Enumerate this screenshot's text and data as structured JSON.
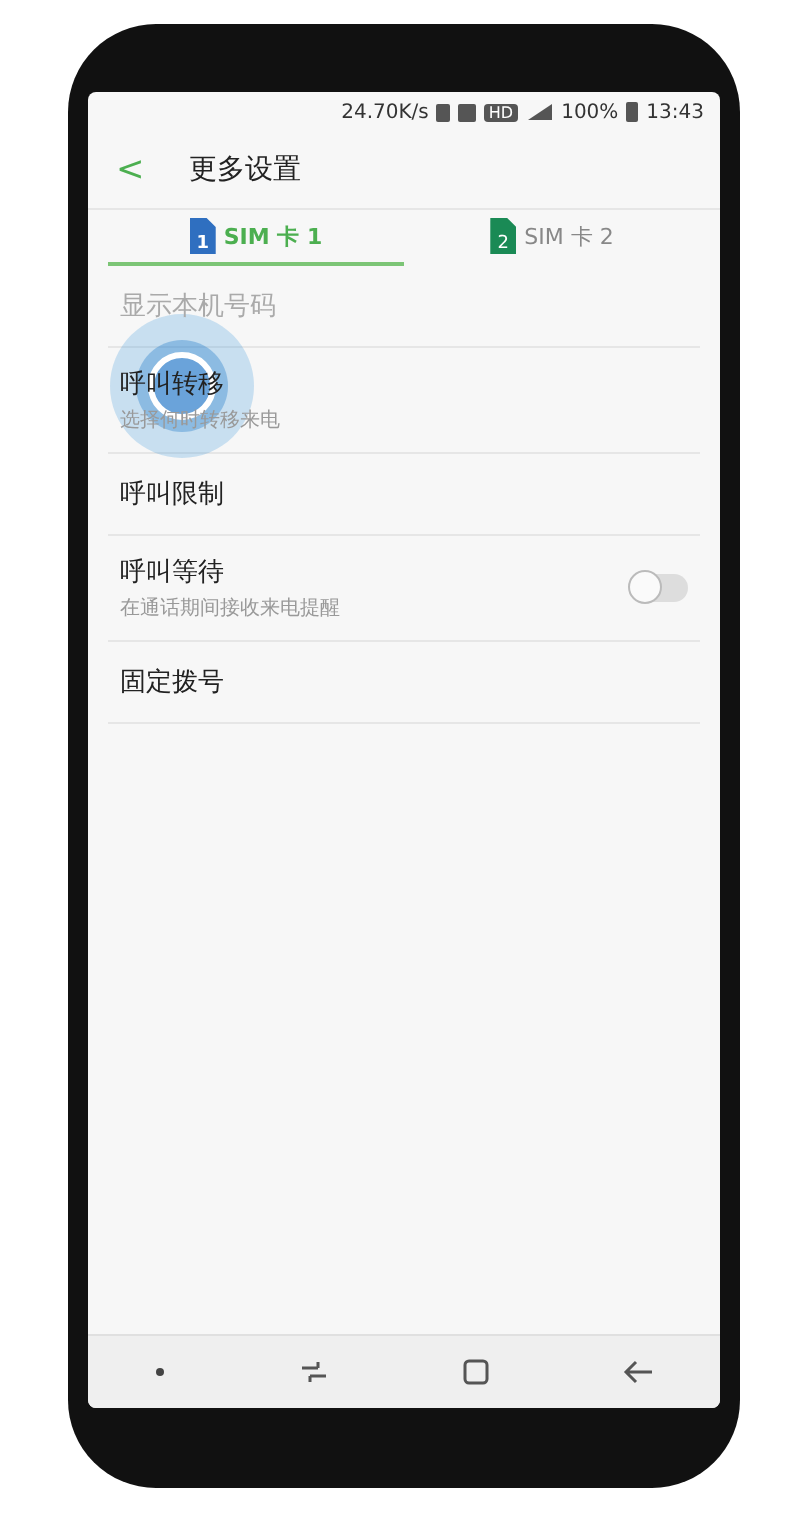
{
  "status_bar": {
    "speed": "24.70K/s",
    "hd": "HD",
    "battery": "100%",
    "time": "13:43"
  },
  "header": {
    "back": "<",
    "title": "更多设置"
  },
  "tabs": [
    {
      "label": "SIM 卡 1",
      "sim": "1",
      "color": "#2f6fc0",
      "selected": true
    },
    {
      "label": "SIM 卡 2",
      "sim": "2",
      "color": "#1a8a55",
      "selected": false
    }
  ],
  "items": [
    {
      "kind": "plain",
      "title": "显示本机号码",
      "disabled": true
    },
    {
      "kind": "plain",
      "title": "呼叫转移",
      "subtitle": "选择何时转移来电",
      "disabled": false,
      "touched": true
    },
    {
      "kind": "plain",
      "title": "呼叫限制",
      "disabled": false
    },
    {
      "kind": "toggle",
      "title": "呼叫等待",
      "subtitle": "在通话期间接收来电提醒",
      "disabled": false,
      "on": false
    },
    {
      "kind": "plain",
      "title": "固定拨号",
      "disabled": false
    }
  ]
}
